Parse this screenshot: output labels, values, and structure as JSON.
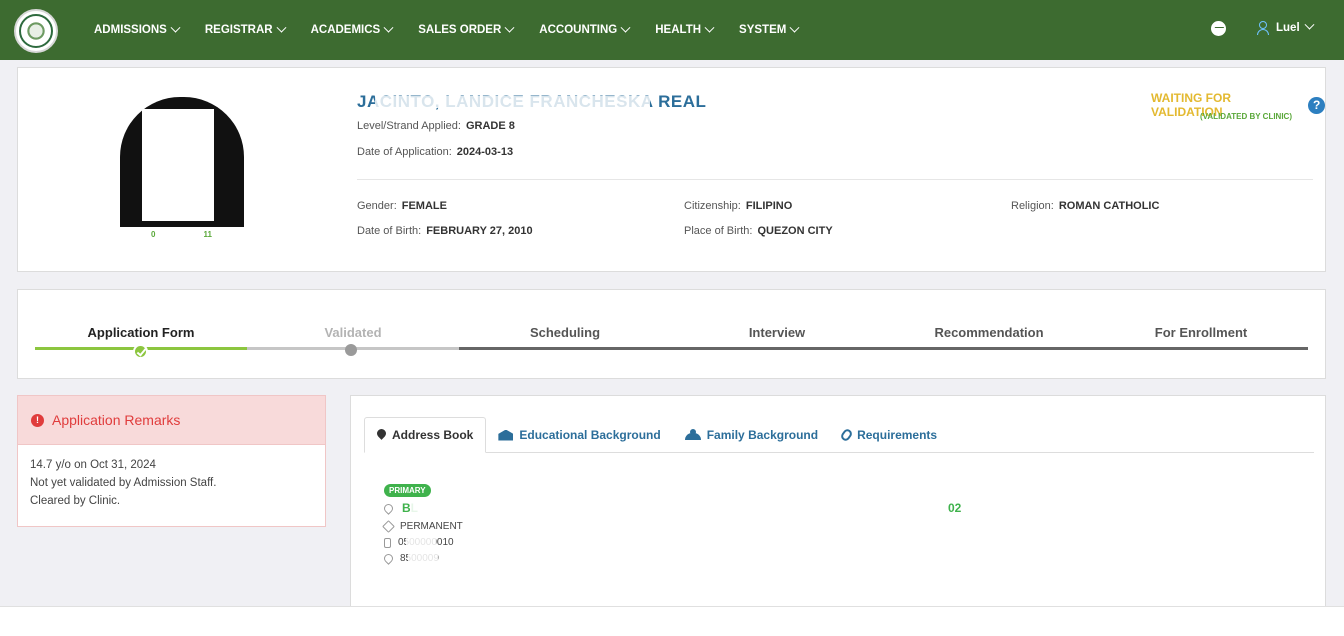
{
  "nav": {
    "menu": [
      "ADMISSIONS",
      "REGISTRAR",
      "ACADEMICS",
      "SALES ORDER",
      "ACCOUNTING",
      "HEALTH",
      "SYSTEM"
    ],
    "user": "Luel"
  },
  "profile": {
    "name": "JACINTO, LANDICE FRANCHESKA REAL",
    "photo_numbers": [
      "0",
      "11"
    ],
    "level_label": "Level/Strand Applied:",
    "level_value": "GRADE 8",
    "date_app_label": "Date of Application:",
    "date_app_value": "2024-03-13",
    "gender_label": "Gender:",
    "gender_value": "FEMALE",
    "citizenship_label": "Citizenship:",
    "citizenship_value": "FILIPINO",
    "religion_label": "Religion:",
    "religion_value": "ROMAN CATHOLIC",
    "dob_label": "Date of Birth:",
    "dob_value": "FEBRUARY 27, 2010",
    "pob_label": "Place of Birth:",
    "pob_value": "QUEZON CITY",
    "status": "WAITING FOR VALIDATION",
    "status_sub": "(VALIDATED BY CLINIC)",
    "status_help": "?"
  },
  "steps": [
    "Application Form",
    "Validated",
    "Scheduling",
    "Interview",
    "Recommendation",
    "For Enrollment"
  ],
  "remarks": {
    "title": "Application Remarks",
    "alert_glyph": "!",
    "lines": [
      "14.7 y/o on Oct 31, 2024",
      "Not yet validated by Admission Staff.",
      "Cleared by Clinic."
    ]
  },
  "tabs": [
    "Address Book",
    "Educational Background",
    "Family Background",
    "Requirements"
  ],
  "address": {
    "badge": "PRIMARY",
    "line_start": "BL",
    "line_end": "02",
    "type": "PERMANENT",
    "mobile": "0500000010",
    "phone": "8500009"
  },
  "colors": {
    "navbar": "#3d6b30",
    "accent_green": "#8cc63f",
    "link_blue": "#2c6e9a",
    "status_yellow": "#e3b930",
    "remarks_red": "#e03c3c"
  }
}
